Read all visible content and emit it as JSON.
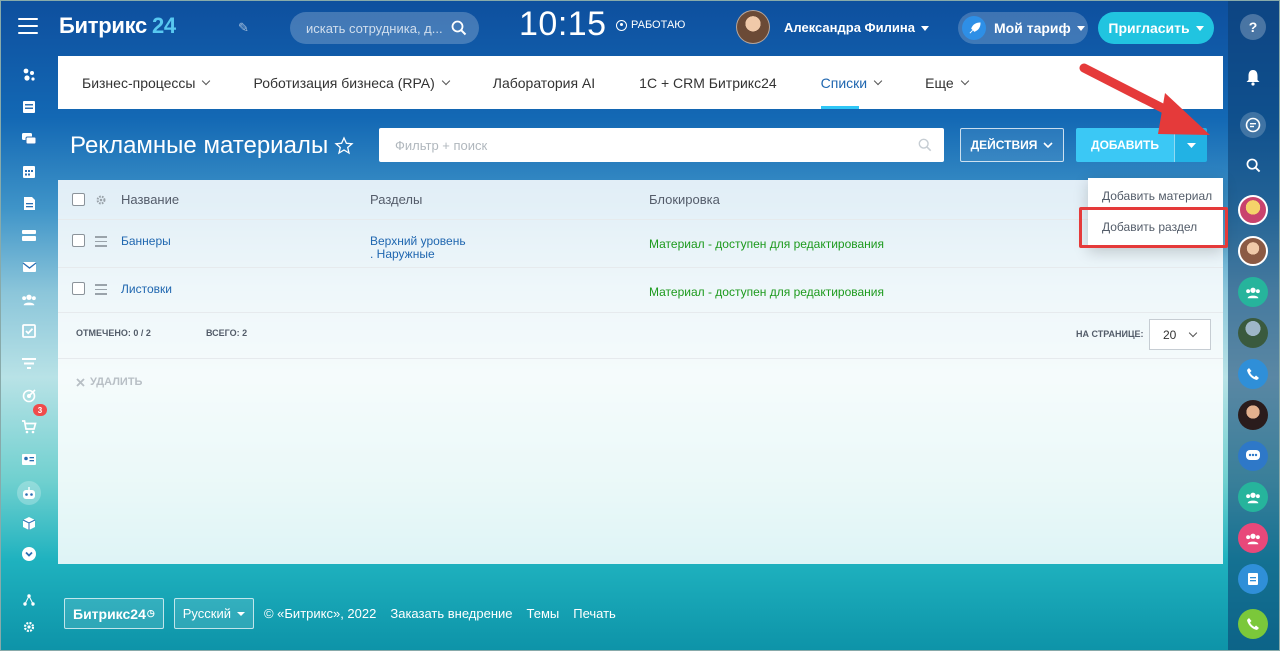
{
  "header": {
    "logo_text": "Битрикс",
    "logo_num": "24",
    "search_placeholder": "искать сотрудника, д...",
    "time": "10:15",
    "work_status": "РАБОТАЮ",
    "user_name": "Александра Филина",
    "tariff_label": "Мой тариф",
    "invite_label": "Пригласить"
  },
  "tabs": [
    {
      "label": "Бизнес-процессы",
      "dropdown": true
    },
    {
      "label": "Роботизация бизнеса (RPA)",
      "dropdown": true
    },
    {
      "label": "Лаборатория AI",
      "dropdown": false
    },
    {
      "label": "1С + CRM Битрикс24",
      "dropdown": false
    },
    {
      "label": "Списки",
      "dropdown": true,
      "active": true
    },
    {
      "label": "Еще",
      "dropdown": true
    }
  ],
  "page": {
    "title": "Рекламные материалы",
    "filter_placeholder": "Фильтр + поиск",
    "actions_label": "ДЕЙСТВИЯ",
    "add_label": "ДОБАВИТЬ"
  },
  "grid": {
    "columns": [
      "Название",
      "Разделы",
      "Блокировка"
    ],
    "rows": [
      {
        "name": "Баннеры",
        "section_line1": "Верхний уровень",
        "section_line2": ". Наружные",
        "lock": "Материал - доступен для редактирования"
      },
      {
        "name": "Листовки",
        "section_line1": "",
        "section_line2": "",
        "lock": "Материал - доступен для редактирования"
      }
    ],
    "checked_label": "ОТМЕЧЕНО:",
    "checked_value": "0 / 2",
    "total_label": "ВСЕГО:",
    "total_value": "2",
    "per_page_label": "НА СТРАНИЦЕ:",
    "per_page_value": "20",
    "delete_label": "УДАЛИТЬ"
  },
  "add_menu": {
    "items": [
      "Добавить материал",
      "Добавить раздел"
    ]
  },
  "left_sidebar": {
    "icons": [
      "feed-icon",
      "tasks-icon",
      "chat-icon",
      "calendar-icon",
      "docs-icon",
      "drive-icon",
      "mail-icon",
      "groups-icon",
      "checklist-icon",
      "filter-icon",
      "target-icon",
      "cart-icon",
      "contact-card-icon",
      "robot-icon",
      "box-icon",
      "more-icon"
    ],
    "badge_count": "3"
  },
  "right_sidebar": {
    "icons": [
      "help-icon",
      "bell-icon",
      "messenger-icon",
      "search-icon",
      "avatar-1",
      "avatar-2",
      "group-chat-icon",
      "avatar-3",
      "phone-icon",
      "avatar-4",
      "open-lines-icon",
      "group-chat-icon",
      "group-chat-icon",
      "tasks-icon",
      "call-icon"
    ]
  },
  "footer": {
    "logo": "Битрикс24",
    "lang": "Русский",
    "copyright": "© «Битрикс», 2022",
    "order_link": "Заказать внедрение",
    "themes_link": "Темы",
    "print_link": "Печать"
  },
  "colors": {
    "accent": "#3bc8f5",
    "link": "#2067b0",
    "ok": "#1d9a1d",
    "highlight": "#e53a3a"
  }
}
